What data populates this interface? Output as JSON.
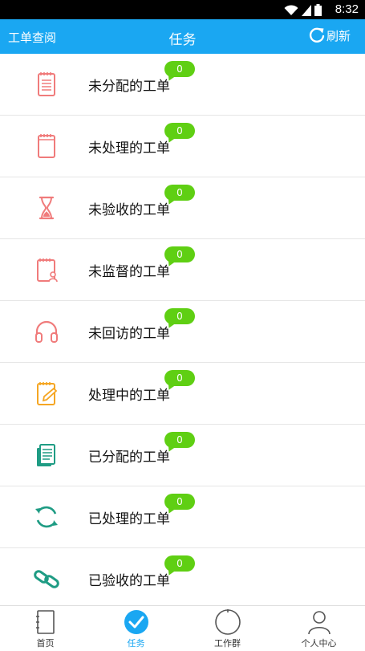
{
  "status_bar": {
    "time": "8:32"
  },
  "app_bar": {
    "left_link": "工单查阅",
    "title": "任务",
    "refresh_label": "刷新"
  },
  "tasks": [
    {
      "label": "未分配的工单",
      "count": "0",
      "icon": "notepad-lines-icon",
      "color": "#f07b7b"
    },
    {
      "label": "未处理的工单",
      "count": "0",
      "icon": "notepad-blank-icon",
      "color": "#f07b7b"
    },
    {
      "label": "未验收的工单",
      "count": "0",
      "icon": "hourglass-icon",
      "color": "#f07b7b"
    },
    {
      "label": "未监督的工单",
      "count": "0",
      "icon": "supervise-user-icon",
      "color": "#f07b7b"
    },
    {
      "label": "未回访的工单",
      "count": "0",
      "icon": "headphones-icon",
      "color": "#f07b7b"
    },
    {
      "label": "处理中的工单",
      "count": "0",
      "icon": "notepad-pencil-icon",
      "color": "#f5a623"
    },
    {
      "label": "已分配的工单",
      "count": "0",
      "icon": "stacked-notes-icon",
      "color": "#1f9c84"
    },
    {
      "label": "已处理的工单",
      "count": "0",
      "icon": "refresh-arrows-icon",
      "color": "#1f9c84"
    },
    {
      "label": "已验收的工单",
      "count": "0",
      "icon": "chain-link-icon",
      "color": "#1f9c84"
    }
  ],
  "tab_bar": {
    "tabs": [
      {
        "label": "首页"
      },
      {
        "label": "任务"
      },
      {
        "label": "工作群"
      },
      {
        "label": "个人中心"
      }
    ],
    "active_color": "#1aa7f2"
  }
}
